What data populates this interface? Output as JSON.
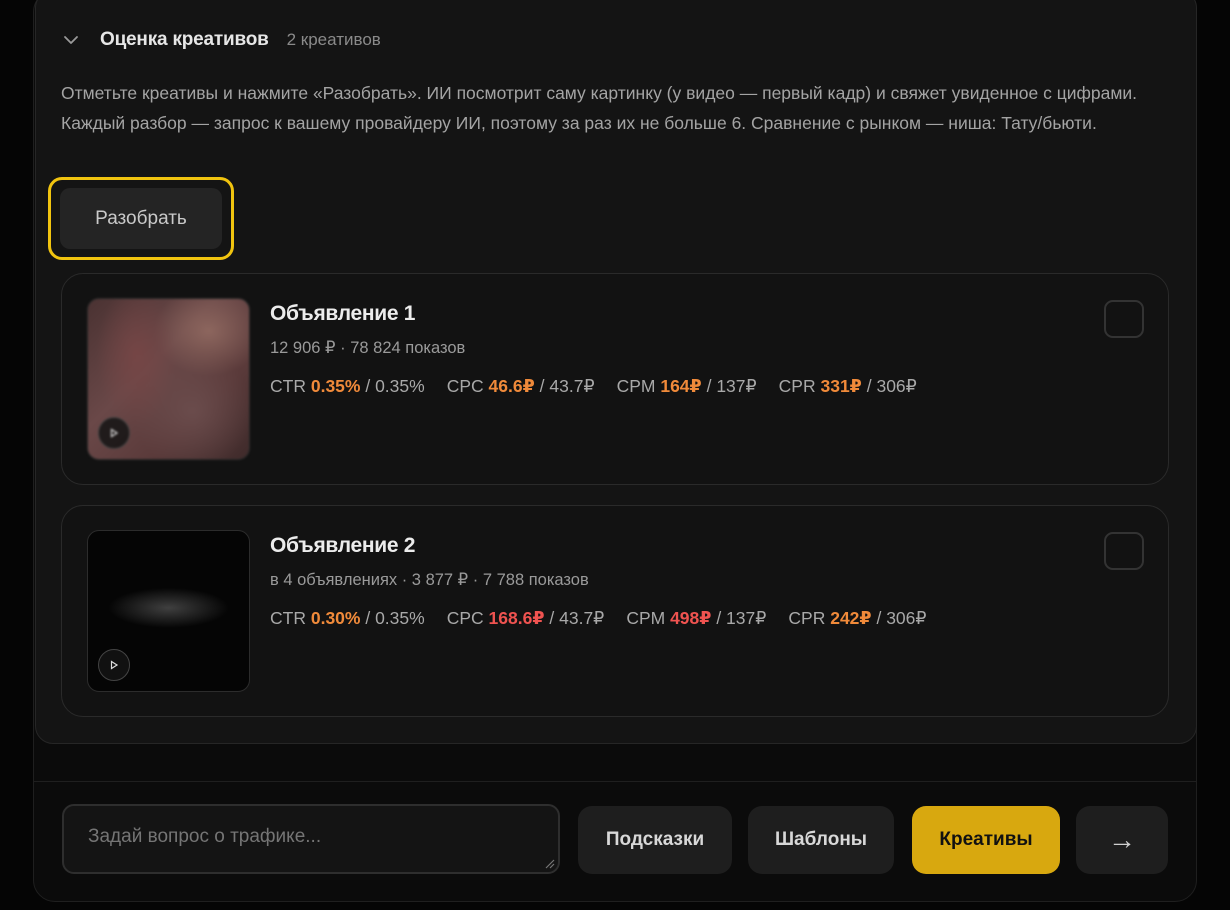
{
  "section": {
    "title": "Оценка креативов",
    "count": "2 креативов",
    "description": "Отметьте креативы и нажмите «Разобрать». ИИ посмотрит саму картинку (у видео — первый кадр) и свяжет увиденное с цифрами. Каждый разбор — запрос к вашему провайдеру ИИ, поэтому за раз их не больше 6. Сравнение с рынком — ниша: Тату/бьюти.",
    "analyze_label": "Разобрать"
  },
  "ads": [
    {
      "title": "Объявление 1",
      "meta": "12 906 ₽ · 78 824 показов",
      "metrics": [
        {
          "name": "CTR",
          "value": "0.35%",
          "bench": "/ 0.35%",
          "status": "orange"
        },
        {
          "name": "CPC",
          "value": "46.6₽",
          "bench": "/ 43.7₽",
          "status": "orange"
        },
        {
          "name": "CPM",
          "value": "164₽",
          "bench": "/ 137₽",
          "status": "orange"
        },
        {
          "name": "CPR",
          "value": "331₽",
          "bench": "/ 306₽",
          "status": "orange"
        }
      ],
      "media": "video"
    },
    {
      "title": "Объявление 2",
      "meta": "в 4 объявлениях · 3 877 ₽ · 7 788 показов",
      "metrics": [
        {
          "name": "CTR",
          "value": "0.30%",
          "bench": "/ 0.35%",
          "status": "orange"
        },
        {
          "name": "CPC",
          "value": "168.6₽",
          "bench": "/ 43.7₽",
          "status": "red"
        },
        {
          "name": "CPM",
          "value": "498₽",
          "bench": "/ 137₽",
          "status": "red"
        },
        {
          "name": "CPR",
          "value": "242₽",
          "bench": "/ 306₽",
          "status": "orange"
        }
      ],
      "media": "video"
    }
  ],
  "composer": {
    "placeholder": "Задай вопрос о трафике...",
    "hints_label": "Подсказки",
    "templates_label": "Шаблоны",
    "creatives_label": "Креативы",
    "send_label": "→"
  },
  "colors": {
    "accent": "#d8a80f",
    "highlight_ring": "#f1c40f",
    "warn": "#f08a3a",
    "bad": "#ef5350"
  }
}
